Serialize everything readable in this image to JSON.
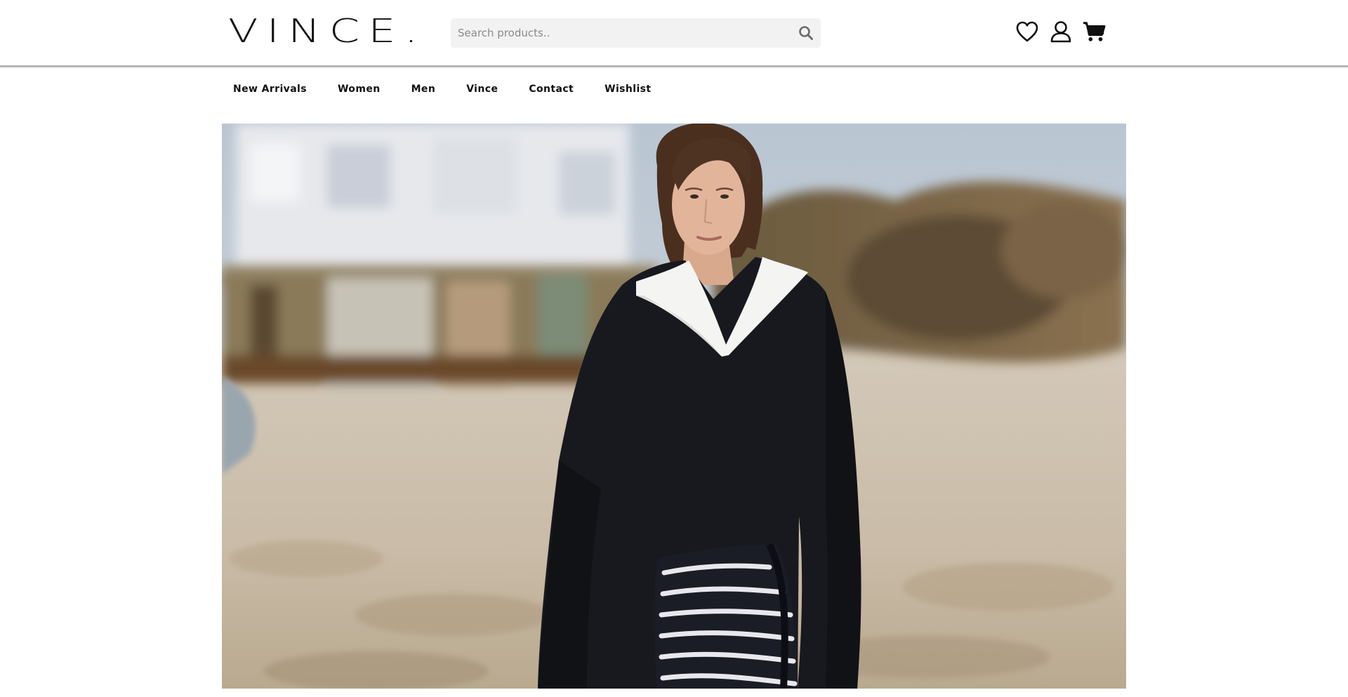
{
  "header": {
    "logo_text": "VINCE.",
    "search": {
      "placeholder": "Search products..",
      "value": ""
    },
    "icons": [
      "heart-icon",
      "user-icon",
      "cart-icon"
    ]
  },
  "nav": {
    "items": [
      {
        "label": "New Arrivals"
      },
      {
        "label": "Women"
      },
      {
        "label": "Men"
      },
      {
        "label": "Vince"
      },
      {
        "label": "Contact"
      },
      {
        "label": "Wishlist"
      }
    ]
  },
  "hero": {
    "description_icon": "hero-photo",
    "colors": {
      "sky": "#c8d2dc",
      "sand": "#cfc3b2",
      "sweater": "#17191e",
      "collar": "#f4f4f2"
    }
  }
}
